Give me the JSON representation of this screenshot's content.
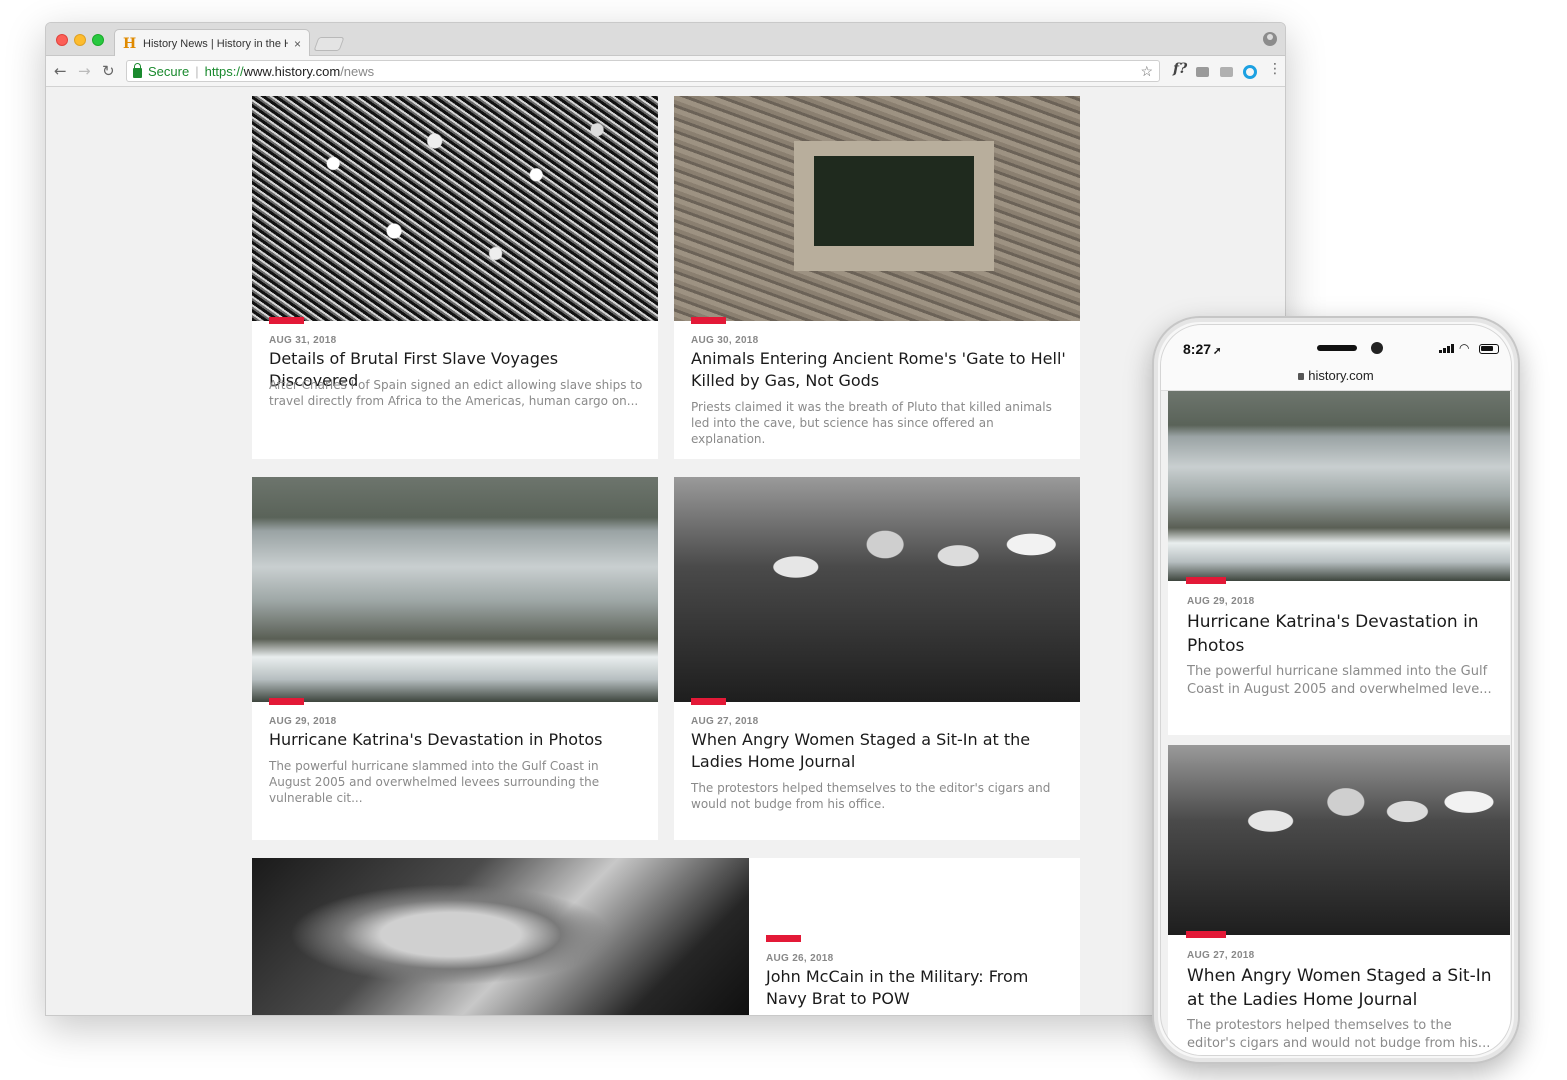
{
  "browser": {
    "tab_title": "History News | History in the H",
    "tab_close": "×",
    "url_secure_label": "Secure",
    "url_scheme": "https://",
    "url_host": "www.history.com",
    "url_path": "/news",
    "favicon_letter": "H",
    "ext_fx": "f?"
  },
  "articles": [
    {
      "date": "AUG 31, 2018",
      "title": "Details of Brutal First Slave Voyages Discovered",
      "desc": "After Charles I of Spain signed an edict allowing slave ships to travel directly from Africa to the Americas, human cargo on..."
    },
    {
      "date": "AUG 30, 2018",
      "title": "Animals Entering Ancient Rome's 'Gate to Hell' Killed by Gas, Not Gods",
      "desc": "Priests claimed it was the breath of Pluto that killed animals led into the cave, but science has since offered an explanation."
    },
    {
      "date": "AUG 29, 2018",
      "title": "Hurricane Katrina's Devastation in Photos",
      "desc": "The powerful hurricane slammed into the Gulf Coast in August 2005 and overwhelmed levees surrounding the vulnerable cit..."
    },
    {
      "date": "AUG 27, 2018",
      "title": "When Angry Women Staged a Sit-In at the Ladies Home Journal",
      "desc": "The protestors helped themselves to the editor's cigars and would not budge from his office."
    },
    {
      "date": "AUG 26, 2018",
      "title": "John McCain in the Military: From Navy Brat to POW"
    }
  ],
  "phone": {
    "time": "8:27",
    "url": "history.com",
    "cards": [
      {
        "date": "AUG 29, 2018",
        "title": "Hurricane Katrina's Devastation in Photos",
        "desc": "The powerful hurricane slammed into the Gulf Coast in August 2005 and overwhelmed leve..."
      },
      {
        "date": "AUG 27, 2018",
        "title": "When Angry Women Staged a Sit-In at the Ladies Home Journal",
        "desc": "The protestors helped themselves to the editor's cigars and would not budge from his..."
      }
    ]
  },
  "colors": {
    "accent": "#e31937",
    "secure_green": "#1a8a2e"
  }
}
